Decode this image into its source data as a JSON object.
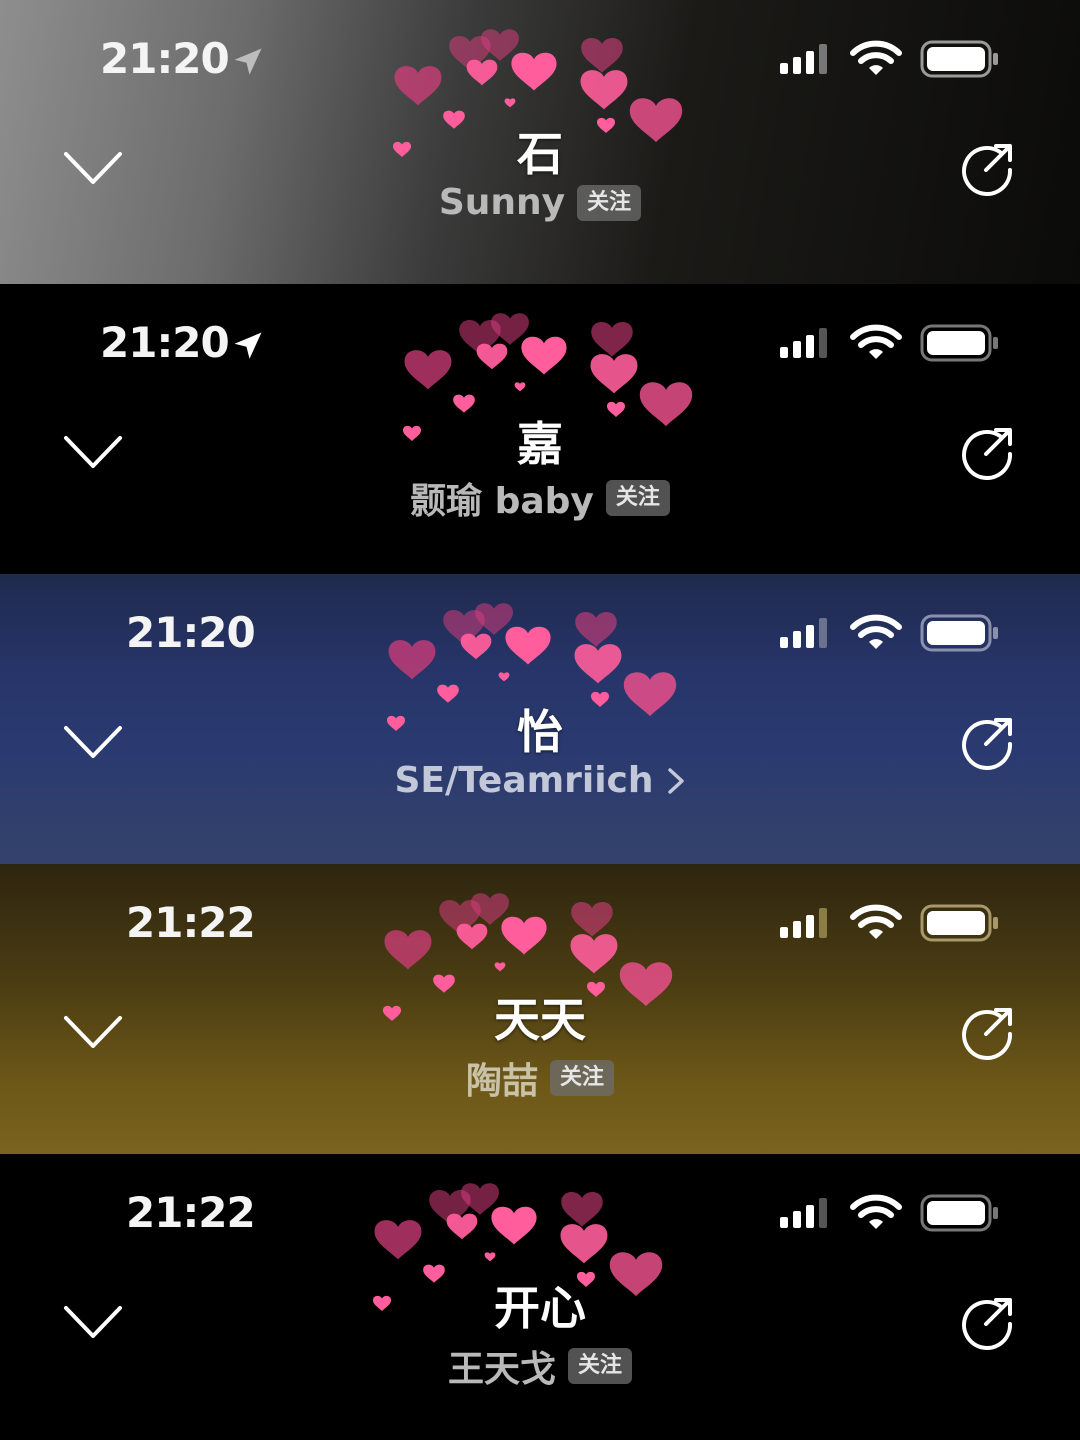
{
  "colors": {
    "heart_light": "#ff5d9b",
    "heart_dark": "#d33d7b",
    "heart_mid": "#e94f8b"
  },
  "panels": [
    {
      "time": "21:20",
      "location_arrow": true,
      "title": "石",
      "subtitle": "Sunny",
      "follow": "关注",
      "chevron_right": false
    },
    {
      "time": "21:20",
      "location_arrow": true,
      "title": "嘉",
      "subtitle": "颢瑜 baby",
      "follow": "关注",
      "chevron_right": false
    },
    {
      "time": "21:20",
      "location_arrow": false,
      "title": "怡",
      "subtitle": "SE/Teamriich",
      "follow": "",
      "chevron_right": true
    },
    {
      "time": "21:22",
      "location_arrow": false,
      "title": "天天",
      "subtitle": "陶喆",
      "follow": "关注",
      "chevron_right": false
    },
    {
      "time": "21:22",
      "location_arrow": false,
      "title": "开心",
      "subtitle": "王天戈",
      "follow": "关注",
      "chevron_right": false
    }
  ],
  "icons": {
    "location": "location-arrow-icon",
    "signal": "cellular-signal-icon",
    "wifi": "wifi-icon",
    "battery": "battery-icon",
    "collapse": "chevron-down-icon",
    "share": "share-icon",
    "heart": "heart-icon"
  }
}
